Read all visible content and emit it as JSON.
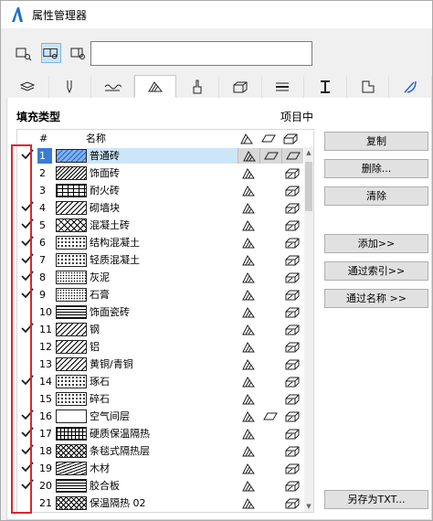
{
  "window": {
    "title": "属性管理器"
  },
  "search": {
    "value": ""
  },
  "section": {
    "title": "填充类型",
    "right_label": "项目中"
  },
  "list": {
    "headers": {
      "num": "#",
      "name": "名称"
    },
    "rows": [
      {
        "checked": true,
        "num": "1",
        "name": "普通砖",
        "pattern": "diag-blue",
        "selected": true,
        "icons": [
          "fill",
          "fill-none",
          "fill-none"
        ]
      },
      {
        "checked": false,
        "num": "2",
        "name": "饰面砖",
        "pattern": "dense",
        "selected": false,
        "icons": [
          "fill",
          "",
          "surface"
        ]
      },
      {
        "checked": false,
        "num": "3",
        "name": "耐火砖",
        "pattern": "brick",
        "selected": false,
        "icons": [
          "fill",
          "",
          "surface"
        ]
      },
      {
        "checked": true,
        "num": "4",
        "name": "砌墙块",
        "pattern": "diag",
        "selected": false,
        "icons": [
          "fill",
          "",
          "surface"
        ]
      },
      {
        "checked": true,
        "num": "5",
        "name": "混凝土砖",
        "pattern": "cross",
        "selected": false,
        "icons": [
          "fill",
          "",
          "surface"
        ]
      },
      {
        "checked": true,
        "num": "6",
        "name": "结构混凝土",
        "pattern": "dots",
        "selected": false,
        "icons": [
          "fill",
          "",
          "surface"
        ]
      },
      {
        "checked": true,
        "num": "7",
        "name": "轻质混凝土",
        "pattern": "dots",
        "selected": false,
        "icons": [
          "fill",
          "",
          "surface"
        ]
      },
      {
        "checked": true,
        "num": "8",
        "name": "灰泥",
        "pattern": "dots-fine",
        "selected": false,
        "icons": [
          "fill",
          "",
          "surface"
        ]
      },
      {
        "checked": true,
        "num": "9",
        "name": "石膏",
        "pattern": "dots-fine",
        "selected": false,
        "icons": [
          "fill",
          "",
          "surface"
        ]
      },
      {
        "checked": false,
        "num": "10",
        "name": "饰面瓷砖",
        "pattern": "hlines",
        "selected": false,
        "icons": [
          "fill",
          "",
          "surface"
        ]
      },
      {
        "checked": true,
        "num": "11",
        "name": "钢",
        "pattern": "diag",
        "selected": false,
        "icons": [
          "fill",
          "",
          "surface"
        ]
      },
      {
        "checked": false,
        "num": "12",
        "name": "铝",
        "pattern": "diag",
        "selected": false,
        "icons": [
          "fill",
          "",
          "surface"
        ]
      },
      {
        "checked": false,
        "num": "13",
        "name": "黄铜/青铜",
        "pattern": "diag",
        "selected": false,
        "icons": [
          "fill",
          "",
          "surface"
        ]
      },
      {
        "checked": true,
        "num": "14",
        "name": "琢石",
        "pattern": "dots",
        "selected": false,
        "icons": [
          "fill",
          "",
          "surface"
        ]
      },
      {
        "checked": false,
        "num": "15",
        "name": "碎石",
        "pattern": "dots",
        "selected": false,
        "icons": [
          "fill",
          "",
          "surface"
        ]
      },
      {
        "checked": true,
        "num": "16",
        "name": "空气间层",
        "pattern": "blank",
        "selected": false,
        "icons": [
          "fill",
          "fill-none",
          "surface"
        ]
      },
      {
        "checked": true,
        "num": "17",
        "name": "硬质保温隔热",
        "pattern": "grid",
        "selected": false,
        "icons": [
          "fill",
          "",
          "surface"
        ]
      },
      {
        "checked": true,
        "num": "18",
        "name": "条毯式隔热层",
        "pattern": "zig",
        "selected": false,
        "icons": [
          "fill",
          "",
          "surface"
        ]
      },
      {
        "checked": true,
        "num": "19",
        "name": "木材",
        "pattern": "wave",
        "selected": false,
        "icons": [
          "fill",
          "",
          "surface"
        ]
      },
      {
        "checked": true,
        "num": "20",
        "name": "胶合板",
        "pattern": "hlines",
        "selected": false,
        "icons": [
          "fill",
          "",
          "surface"
        ]
      },
      {
        "checked": false,
        "num": "21",
        "name": "保温隔热 02",
        "pattern": "zig",
        "selected": false,
        "icons": [
          "fill",
          "",
          "surface"
        ]
      }
    ]
  },
  "buttons": {
    "duplicate": "复制",
    "delete": "删除...",
    "clear": "清除",
    "add": "添加>>",
    "by_index": "通过索引>>",
    "by_name": "通过名称 >>",
    "save_txt": "另存为TXT..."
  },
  "tabs": [
    "layers-icon",
    "pen-icon",
    "line-type-icon",
    "fill-type-icon",
    "surface-icon",
    "building-material-icon",
    "composite-icon",
    "profile-icon",
    "zone-icon",
    "operation-profile-icon"
  ],
  "colors": {
    "accent": "#3a7bd5",
    "highlight_box": "#e0242a"
  }
}
